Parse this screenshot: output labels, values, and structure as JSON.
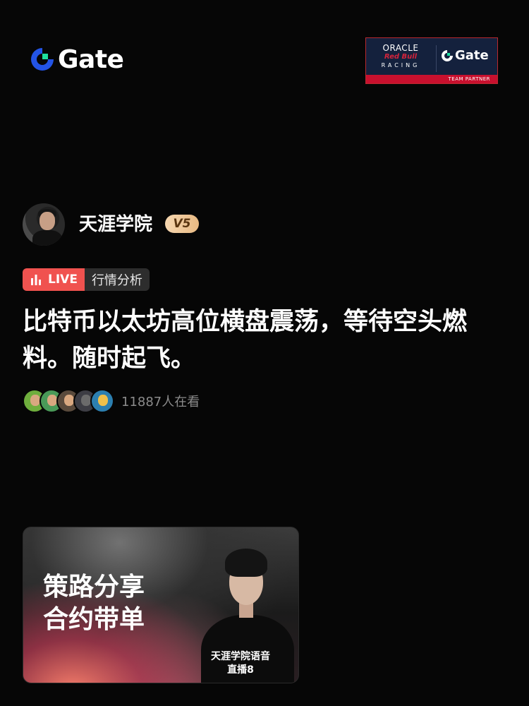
{
  "header": {
    "brand_name": "Gate",
    "brand_color": "#2354e6",
    "partner": {
      "oracle": "ORACLE",
      "redbull": "Red Bull",
      "racing": "RACING",
      "gate": "Gate",
      "strip": "TEAM PARTNER",
      "bg_color": "#14213d",
      "strip_color": "#c8102e"
    }
  },
  "host": {
    "name": "天涯学院",
    "vip_level": "V5",
    "avatar_icon": "host-avatar"
  },
  "live_tag": {
    "live_label": "LIVE",
    "category": "行情分析",
    "live_color": "#f0524f"
  },
  "title": "比特币以太坊高位横盘震荡，等待空头燃料。随时起飞。",
  "viewers": {
    "count_text": "11887人在看",
    "avatar_count": 5
  },
  "card": {
    "line1": "策路分享",
    "line2": "合约带单",
    "caption_line1": "天涯学院语音",
    "caption_line2": "直播8"
  }
}
